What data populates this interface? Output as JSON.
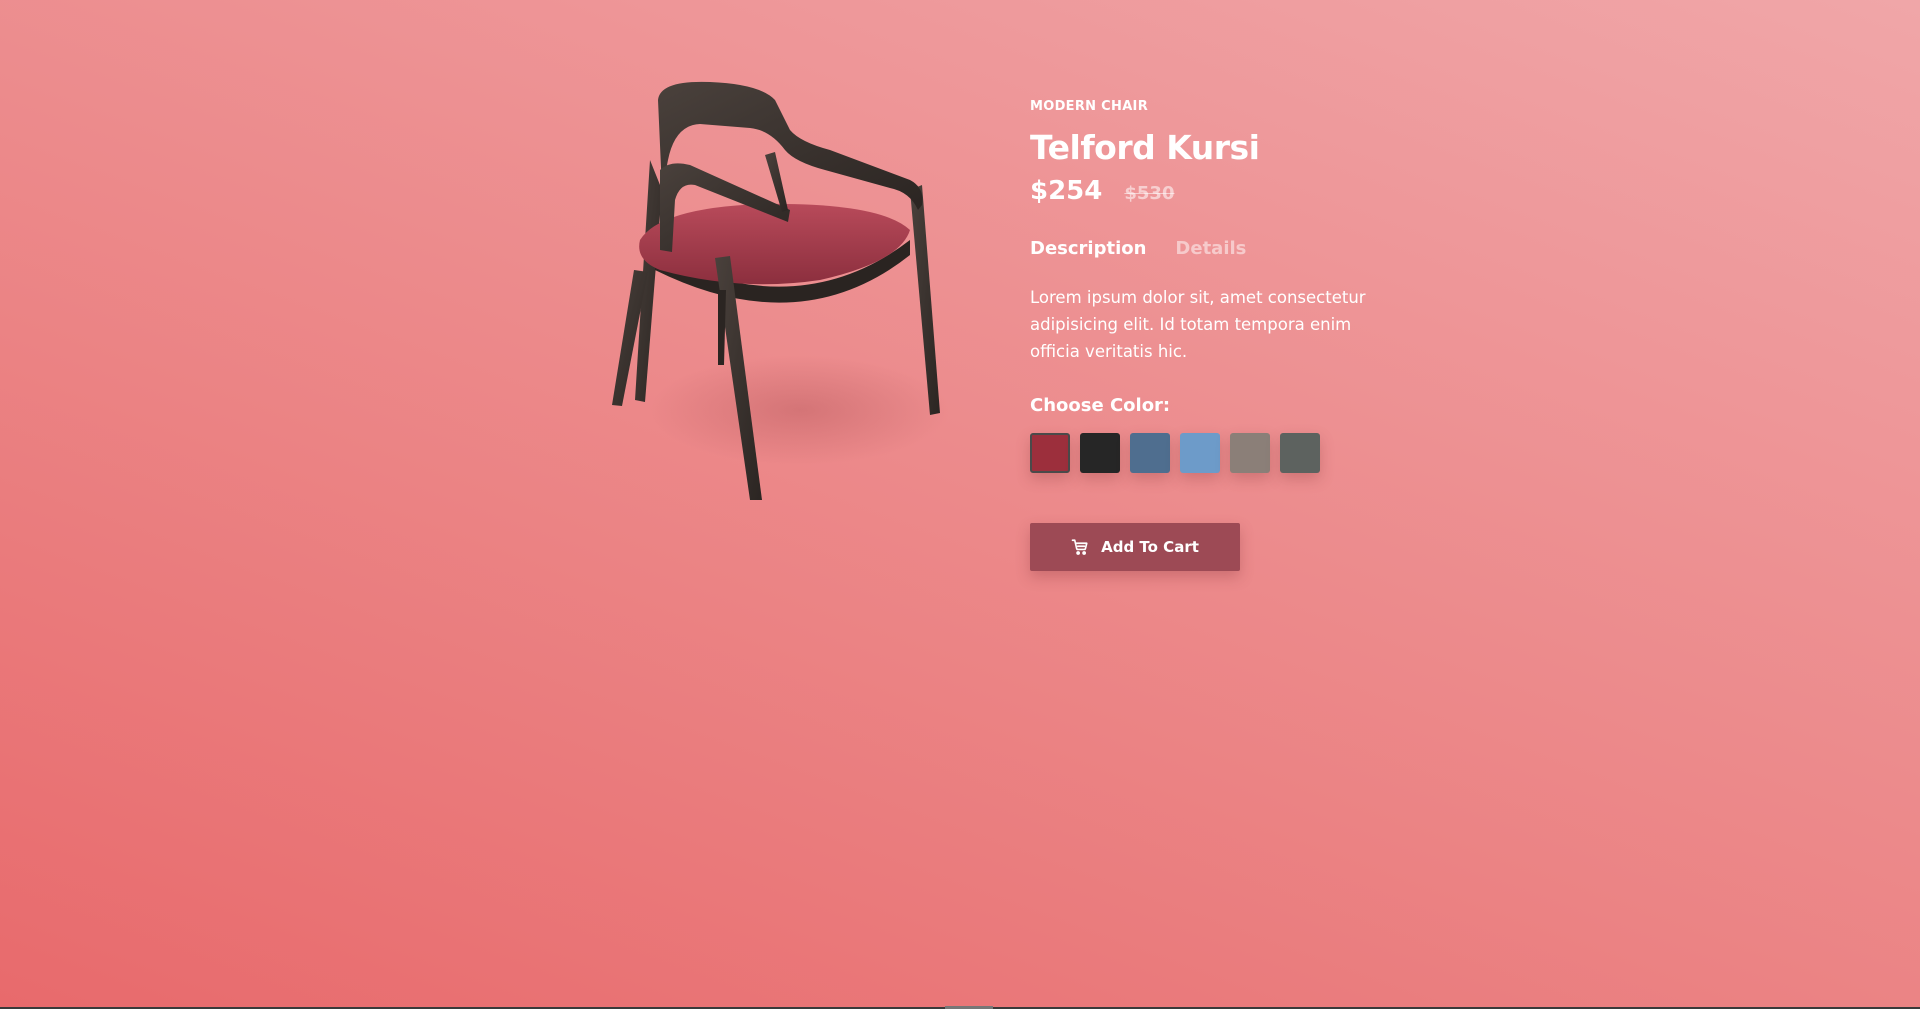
{
  "product": {
    "category": "MODERN CHAIR",
    "title": "Telford Kursi",
    "price": "$254",
    "old_price": "$530",
    "image_icon": "chair-image"
  },
  "tabs": [
    {
      "label": "Description",
      "active": true
    },
    {
      "label": "Details",
      "active": false
    }
  ],
  "description": "Lorem ipsum dolor sit, amet consectetur adipisicing elit. Id totam tempora enim officia veritatis hic.",
  "color_picker": {
    "label": "Choose Color:",
    "swatches": [
      {
        "name": "red",
        "color": "#9c2f3c",
        "selected": true
      },
      {
        "name": "black",
        "color": "#262626",
        "selected": false
      },
      {
        "name": "denim",
        "color": "#4f6e8f",
        "selected": false
      },
      {
        "name": "light-blue",
        "color": "#6d9bc9",
        "selected": false
      },
      {
        "name": "taupe",
        "color": "#8b7f78",
        "selected": false
      },
      {
        "name": "grey",
        "color": "#5d625f",
        "selected": false
      }
    ]
  },
  "cart_button": {
    "label": "Add To Cart",
    "icon": "cart-icon"
  },
  "colors": {
    "accent": "#9d4a55",
    "background_top": "#f0a6a8",
    "background_bottom": "#e86a6c"
  }
}
